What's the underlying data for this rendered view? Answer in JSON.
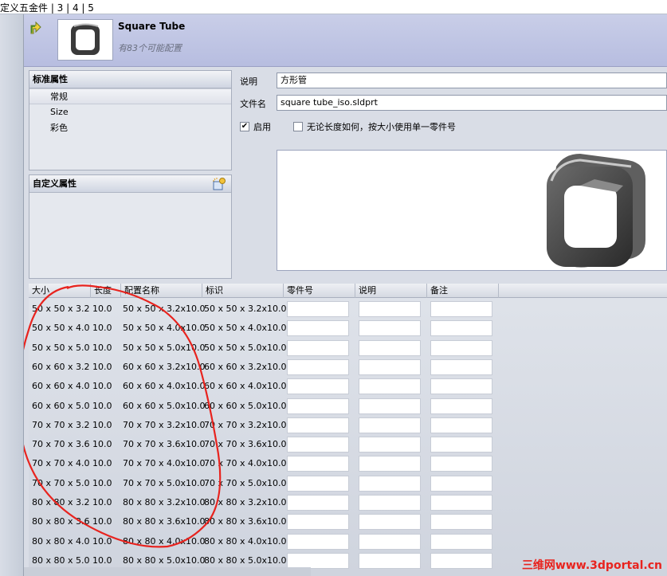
{
  "topbar": {
    "crumb": "定义五金件 | 3 | 4 | 5"
  },
  "header": {
    "title": "Square Tube",
    "subtitle": "有83个可能配置"
  },
  "standard_panel": {
    "title": "标准属性",
    "items": [
      "常规",
      "Size",
      "彩色"
    ]
  },
  "custom_panel": {
    "title": "自定义属性"
  },
  "form": {
    "desc_label": "说明",
    "desc_value": "方形管",
    "file_label": "文件名",
    "file_value": "square tube_iso.sldprt",
    "enable_label": "启用",
    "enable_checked": "✔",
    "unique_label": "无论长度如何，按大小使用单一零件号"
  },
  "grid": {
    "columns": [
      "大小",
      "长度",
      "配置名称",
      "标识",
      "零件号",
      "说明",
      "备注"
    ],
    "rows": [
      [
        "50 x 50 x 3.2",
        "10.0",
        "50 x 50 x 3.2x10.0",
        "50 x 50 x 3.2x10.0"
      ],
      [
        "50 x 50 x 4.0",
        "10.0",
        "50 x 50 x 4.0x10.0",
        "50 x 50 x 4.0x10.0"
      ],
      [
        "50 x 50 x 5.0",
        "10.0",
        "50 x 50 x 5.0x10.0",
        "50 x 50 x 5.0x10.0"
      ],
      [
        "60 x 60 x 3.2",
        "10.0",
        "60 x 60 x 3.2x10.0",
        "60 x 60 x 3.2x10.0"
      ],
      [
        "60 x 60 x 4.0",
        "10.0",
        "60 x 60 x 4.0x10.0",
        "60 x 60 x 4.0x10.0"
      ],
      [
        "60 x 60 x 5.0",
        "10.0",
        "60 x 60 x 5.0x10.0",
        "60 x 60 x 5.0x10.0"
      ],
      [
        "70 x 70 x 3.2",
        "10.0",
        "70 x 70 x 3.2x10.0",
        "70 x 70 x 3.2x10.0"
      ],
      [
        "70 x 70 x 3.6",
        "10.0",
        "70 x 70 x 3.6x10.0",
        "70 x 70 x 3.6x10.0"
      ],
      [
        "70 x 70 x 4.0",
        "10.0",
        "70 x 70 x 4.0x10.0",
        "70 x 70 x 4.0x10.0"
      ],
      [
        "70 x 70 x 5.0",
        "10.0",
        "70 x 70 x 5.0x10.0",
        "70 x 70 x 5.0x10.0"
      ],
      [
        "80 x 80 x 3.2",
        "10.0",
        "80 x 80 x 3.2x10.0",
        "80 x 80 x 3.2x10.0"
      ],
      [
        "80 x 80 x 3.6",
        "10.0",
        "80 x 80 x 3.6x10.0",
        "80 x 80 x 3.6x10.0"
      ],
      [
        "80 x 80 x 4.0",
        "10.0",
        "80 x 80 x 4.0x10.0",
        "80 x 80 x 4.0x10.0"
      ],
      [
        "80 x 80 x 5.0",
        "10.0",
        "80 x 80 x 5.0x10.0",
        "80 x 80 x 5.0x10.0"
      ]
    ]
  },
  "watermark": "三维网www.3dportal.cn",
  "colors": {
    "annotation": "#e8231e",
    "header_bg": "#bfc4e4"
  }
}
